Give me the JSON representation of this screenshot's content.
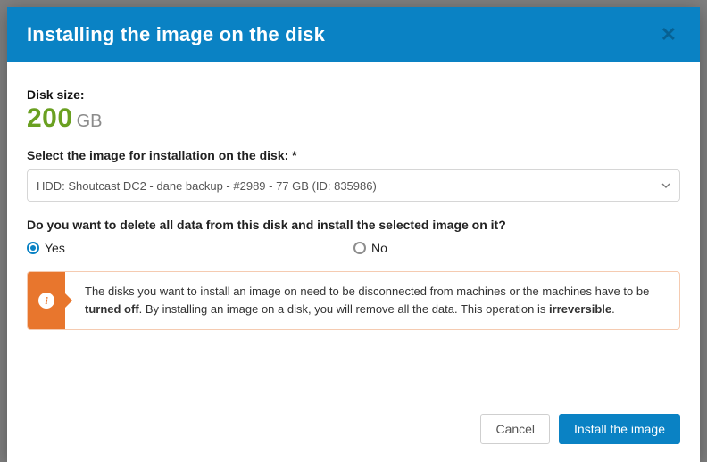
{
  "modal": {
    "title": "Installing the image on the disk",
    "close": "✕"
  },
  "disk_size": {
    "label": "Disk size:",
    "value": "200",
    "unit": "GB"
  },
  "image_select": {
    "label": "Select the image for installation on the disk: *",
    "value": "HDD: Shoutcast DC2 - dane backup - #2989 - 77 GB (ID: 835986)"
  },
  "confirm": {
    "question": "Do you want to delete all data from this disk and install the selected image on it?",
    "yes": "Yes",
    "no": "No"
  },
  "alert": {
    "pre": "The disks you want to install an image on need to be disconnected from machines or the machines have to be ",
    "bold1": "turned off",
    "mid": ". By installing an image on a disk, you will remove all the data. This operation is ",
    "bold2": "irreversible",
    "post": "."
  },
  "footer": {
    "cancel": "Cancel",
    "confirm": "Install the image"
  }
}
